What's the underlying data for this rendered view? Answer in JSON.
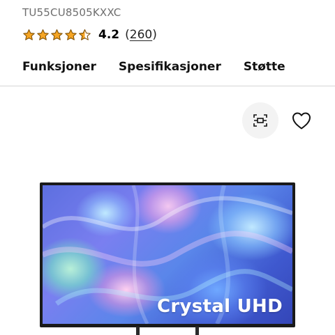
{
  "product": {
    "model_code": "TU55CU8505KXXC",
    "rating": {
      "value": "4.2",
      "stars_out_of_5": 4.2,
      "count_open": "(",
      "count": "260",
      "count_close": ")"
    },
    "image_overlay_text": "Crystal UHD"
  },
  "tabs": [
    {
      "label": "Funksjoner"
    },
    {
      "label": "Spesifikasjoner"
    },
    {
      "label": "Støtte"
    }
  ],
  "actions": {
    "view_icon": "view-in-room-icon",
    "wishlist_icon": "heart-icon"
  },
  "colors": {
    "star": "#f5a524",
    "star_outline": "#8a5a00",
    "text_muted": "#6e6e6e",
    "divider": "#d6d6d6",
    "icon_button_bg": "#f3f3f3"
  }
}
